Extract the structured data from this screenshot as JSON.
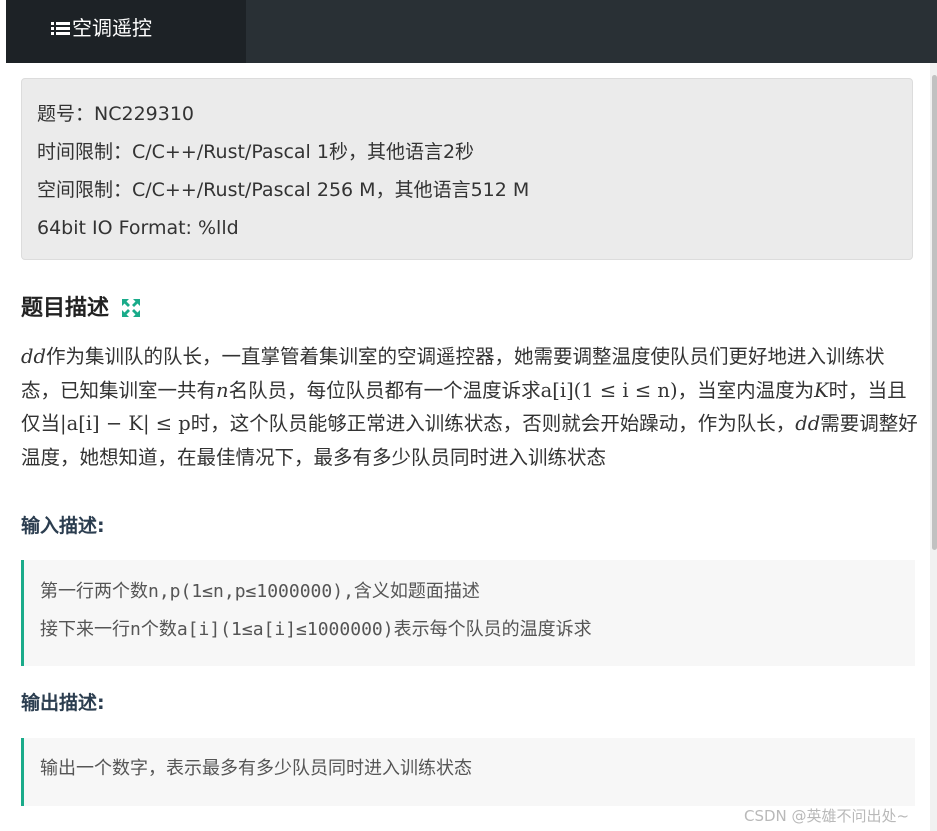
{
  "header": {
    "tab_label": "空调遥控"
  },
  "info": {
    "line1": "题号：NC229310",
    "line2": "时间限制：C/C++/Rust/Pascal 1秒，其他语言2秒",
    "line3": "空间限制：C/C++/Rust/Pascal 256 M，其他语言512 M",
    "line4": "64bit IO Format: %lld"
  },
  "description": {
    "title": "题目描述",
    "expand_icon": "expand-arrows-icon",
    "p_dd1": "dd",
    "p_t1": "作为集训队的队长，一直掌管着集训室的空调遥控器，她需要调整温度使队员们更好地进入训练状态，已知集训室一共有",
    "p_n1": "n",
    "p_t2": "名队员，每位队员都有一个温度诉求",
    "p_expr1": "a[i](1 ≤ i ≤ n)",
    "p_t3": "，当室内温度为",
    "p_K1": "K",
    "p_t4": "时，当且仅当",
    "p_expr2": "|a[i] − K| ≤ p",
    "p_t5": "时，这个队员能够正常进入训练状态，否则就会开始躁动，作为队长，",
    "p_dd2": "dd",
    "p_t6": "需要调整好温度，她想知道，在最佳情况下，最多有多少队员同时进入训练状态"
  },
  "input": {
    "title": "输入描述:",
    "line1": "第一行两个数n,p(1≤n,p≤1000000),含义如题面描述",
    "line2": "接下来一行n个数a[i](1≤a[i]≤1000000)表示每个队员的温度诉求"
  },
  "output": {
    "title": "输出描述:",
    "line1": "输出一个数字，表示最多有多少队员同时进入训练状态"
  },
  "watermark": "CSDN @英雄不问出处~",
  "colors": {
    "topbar": "#293035",
    "tab_active": "#1d2226",
    "accent": "#1aab8a"
  }
}
